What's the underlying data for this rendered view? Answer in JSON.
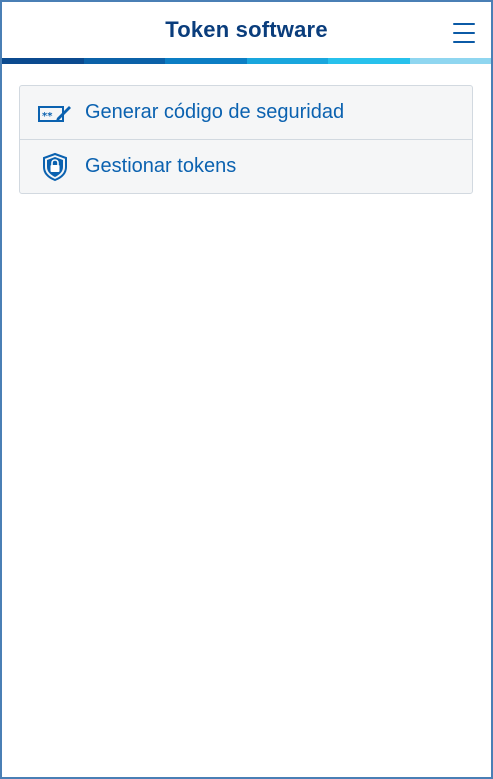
{
  "header": {
    "title": "Token software",
    "menu_icon": "hamburger-menu-icon"
  },
  "stripe_colors": [
    "#0b4a8f",
    "#0b61a8",
    "#0c7ec4",
    "#19a6dd",
    "#27c1ec",
    "#8fd6f0"
  ],
  "menu": {
    "items": [
      {
        "label": "Generar código de seguridad",
        "icon": "security-code-pencil-icon"
      },
      {
        "label": "Gestionar tokens",
        "icon": "shield-lock-icon"
      }
    ]
  },
  "colors": {
    "title": "#0a3d7c",
    "accent": "#0b62b0",
    "border": "#4a7fb5"
  }
}
